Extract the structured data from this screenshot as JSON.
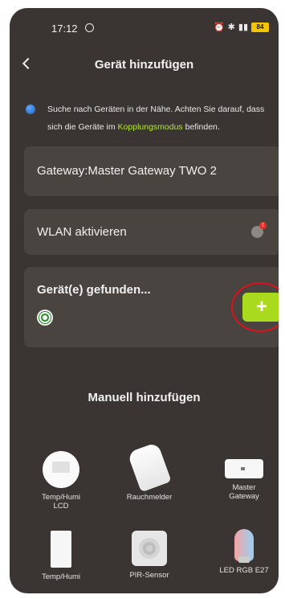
{
  "status_bar": {
    "time": "17:12",
    "battery": "84"
  },
  "header": {
    "title": "Gerät hinzufügen",
    "back_icon": "chevron-left-icon"
  },
  "hint": {
    "text_before": "Suche nach Geräten in der Nähe. Achten Sie darauf, dass sich die Geräte im ",
    "link_text": "Kopplungsmodus",
    "text_after": " befinden."
  },
  "cards": {
    "gateway_label": "Gateway:Master Gateway TWO 2",
    "wlan_label": "WLAN aktivieren",
    "wlan_badge": "!",
    "found_label": "Gerät(e) gefunden...",
    "add_button_label": "+"
  },
  "manual": {
    "title": "Manuell hinzufügen",
    "devices": [
      {
        "label_line1": "Temp/Humi",
        "label_line2": "LCD"
      },
      {
        "label_line1": "Rauchmelder",
        "label_line2": ""
      },
      {
        "label_line1": "Master",
        "label_line2": "Gateway"
      },
      {
        "label_line1": "Temp/Humi",
        "label_line2": ""
      },
      {
        "label_line1": "PIR-Sensor",
        "label_line2": ""
      },
      {
        "label_line1": "LED RGB E27",
        "label_line2": ""
      }
    ]
  },
  "colors": {
    "background": "#3a3532",
    "card": "#4a4441",
    "accent_green": "#a9da1e",
    "link_green": "#b5e43a",
    "highlight_red": "#e0101a"
  }
}
